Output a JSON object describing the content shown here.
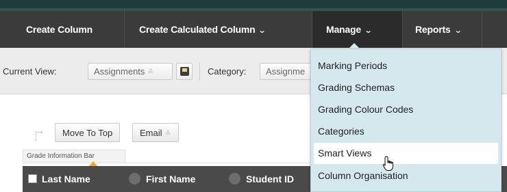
{
  "menubar": {
    "items": [
      {
        "label": "Create Column",
        "has_menu": false
      },
      {
        "label": "Create Calculated Column",
        "has_menu": true
      },
      {
        "label": "Manage",
        "has_menu": true,
        "active": true
      },
      {
        "label": "Reports",
        "has_menu": true
      }
    ],
    "chevron": "⌄"
  },
  "viewbar": {
    "current_view_label": "Current View:",
    "current_view_value": "Assignments",
    "category_label": "Category:",
    "category_value": "Assignme",
    "save_icon": "floppy-disk-icon"
  },
  "actions": {
    "move_to_top": "Move To Top",
    "email": "Email"
  },
  "grade_info_bar": "Grade Information Bar",
  "table_header": {
    "columns": [
      "Last Name",
      "First Name",
      "Student ID"
    ]
  },
  "manage_menu": {
    "items": [
      {
        "label": "Marking Periods"
      },
      {
        "label": "Grading Schemas"
      },
      {
        "label": "Grading Colour Codes"
      },
      {
        "label": "Categories"
      },
      {
        "label": "Smart Views",
        "hover": true
      },
      {
        "label": "Column Organisation"
      }
    ]
  },
  "colors": {
    "menubar": "#3b3b3b",
    "dropdown_bg": "#d4e8ee",
    "header_bar": "#4a4a4a",
    "accent_caret": "#f5a623"
  }
}
